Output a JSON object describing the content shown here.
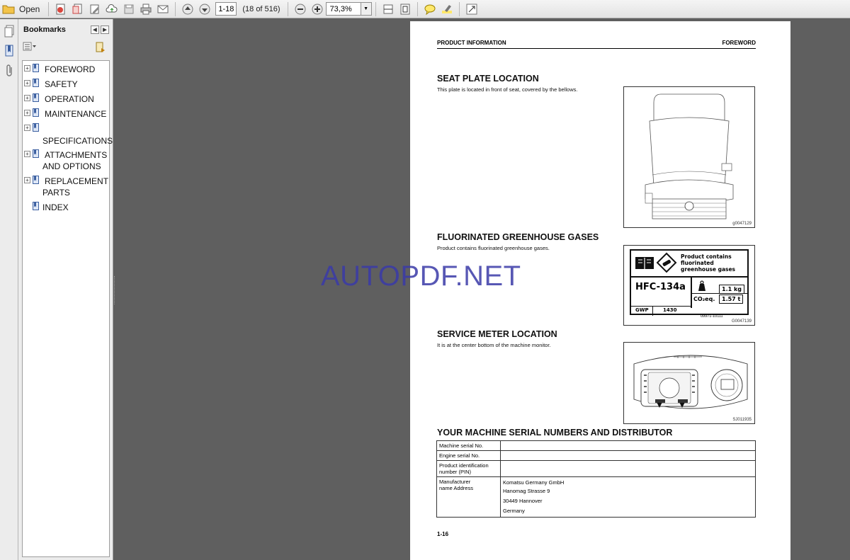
{
  "toolbar": {
    "open_label": "Open",
    "page_input": "1-18",
    "page_count": "(18 of 516)",
    "zoom": "73,3%"
  },
  "bookmarks_panel": {
    "title": "Bookmarks",
    "items": [
      {
        "label": "FOREWORD",
        "expandable": true
      },
      {
        "label": "SAFETY",
        "expandable": true
      },
      {
        "label": "OPERATION",
        "expandable": true
      },
      {
        "label": "MAINTENANCE",
        "expandable": true
      },
      {
        "label": "SPECIFICATIONS",
        "expandable": true
      },
      {
        "label": "ATTACHMENTS AND OPTIONS",
        "expandable": true
      },
      {
        "label": "REPLACEMENT PARTS",
        "expandable": true
      },
      {
        "label": "INDEX",
        "expandable": false
      }
    ]
  },
  "page": {
    "header_left": "PRODUCT INFORMATION",
    "header_right": "FOREWORD",
    "sections": [
      {
        "title": "SEAT PLATE LOCATION",
        "text": "This plate is located in front of seat, covered by the bellows.",
        "figure_code": "g0047129"
      },
      {
        "title": "FLUORINATED GREENHOUSE GASES",
        "text": "Product contains fluorinated greenhouse gases.",
        "figure_code": "G0047139"
      },
      {
        "title": "SERVICE METER LOCATION",
        "text": "It is at the center bottom of the machine monitor.",
        "figure_code": "SJ011935"
      },
      {
        "title": "YOUR MACHINE SERIAL NUMBERS AND DISTRIBUTOR"
      }
    ],
    "fgas_label": {
      "line1": "Product contains",
      "line2": "fluorinated",
      "line3": "greenhouse gases",
      "gas": "HFC-134a",
      "mass": "1.1 kg",
      "co2_label": "CO₂eq.",
      "co2_value": "1.57 t",
      "gwp_label": "GWP",
      "gwp_value": "1430",
      "part_number": "09971-10111"
    },
    "serial_table": [
      {
        "key": "Machine serial No.",
        "value": ""
      },
      {
        "key": "Engine serial No.",
        "value": ""
      },
      {
        "key": "Product identification number (PIN)",
        "value": ""
      },
      {
        "key": "Manufacturer name Address",
        "value_lines": [
          "Komatsu Germany GmbH",
          "Hanomag Strasse 9",
          "30449 Hannover",
          "Germany"
        ]
      }
    ],
    "page_number": "1-16"
  },
  "watermark": "AUTOPDF.NET"
}
